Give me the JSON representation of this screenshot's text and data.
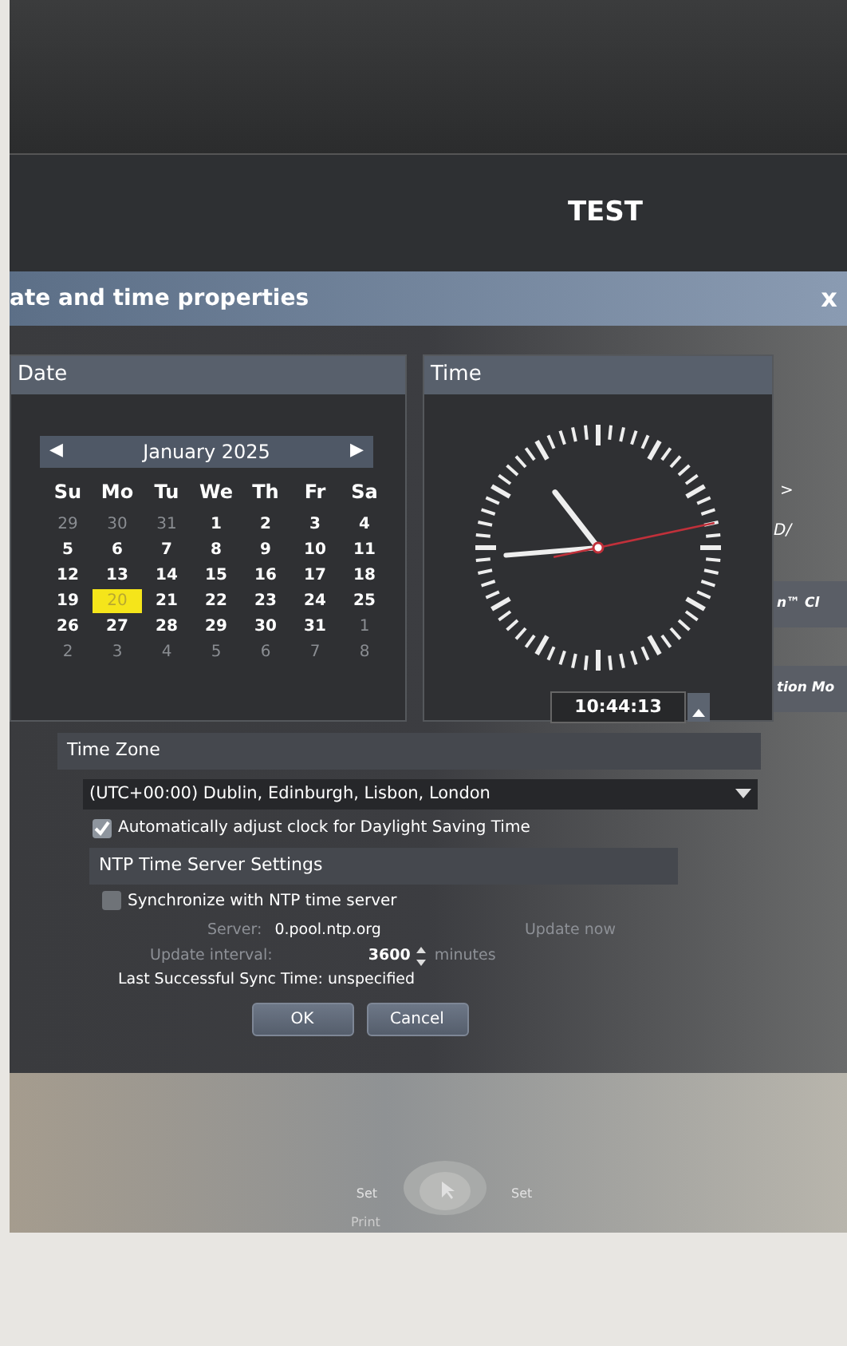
{
  "header": {
    "title": "TEST"
  },
  "dialog": {
    "title": "ate and time properties",
    "close": "x"
  },
  "date_panel": {
    "title": "Date",
    "calendar": {
      "prev": "◀",
      "month": "January 2025",
      "next": "▶",
      "weekdays": [
        "Su",
        "Mo",
        "Tu",
        "We",
        "Th",
        "Fr",
        "Sa"
      ],
      "weeks": [
        [
          {
            "day": "29",
            "muted": true,
            "selected": false
          },
          {
            "day": "30",
            "muted": true,
            "selected": false
          },
          {
            "day": "31",
            "muted": true,
            "selected": false
          },
          {
            "day": "1",
            "muted": false,
            "selected": false
          },
          {
            "day": "2",
            "muted": false,
            "selected": false
          },
          {
            "day": "3",
            "muted": false,
            "selected": false
          },
          {
            "day": "4",
            "muted": false,
            "selected": false
          }
        ],
        [
          {
            "day": "5",
            "muted": false,
            "selected": false
          },
          {
            "day": "6",
            "muted": false,
            "selected": false
          },
          {
            "day": "7",
            "muted": false,
            "selected": false
          },
          {
            "day": "8",
            "muted": false,
            "selected": false
          },
          {
            "day": "9",
            "muted": false,
            "selected": false
          },
          {
            "day": "10",
            "muted": false,
            "selected": false
          },
          {
            "day": "11",
            "muted": false,
            "selected": false
          }
        ],
        [
          {
            "day": "12",
            "muted": false,
            "selected": false
          },
          {
            "day": "13",
            "muted": false,
            "selected": false
          },
          {
            "day": "14",
            "muted": false,
            "selected": false
          },
          {
            "day": "15",
            "muted": false,
            "selected": false
          },
          {
            "day": "16",
            "muted": false,
            "selected": false
          },
          {
            "day": "17",
            "muted": false,
            "selected": false
          },
          {
            "day": "18",
            "muted": false,
            "selected": false
          }
        ],
        [
          {
            "day": "19",
            "muted": false,
            "selected": false
          },
          {
            "day": "20",
            "muted": false,
            "selected": true
          },
          {
            "day": "21",
            "muted": false,
            "selected": false
          },
          {
            "day": "22",
            "muted": false,
            "selected": false
          },
          {
            "day": "23",
            "muted": false,
            "selected": false
          },
          {
            "day": "24",
            "muted": false,
            "selected": false
          },
          {
            "day": "25",
            "muted": false,
            "selected": false
          }
        ],
        [
          {
            "day": "26",
            "muted": false,
            "selected": false
          },
          {
            "day": "27",
            "muted": false,
            "selected": false
          },
          {
            "day": "28",
            "muted": false,
            "selected": false
          },
          {
            "day": "29",
            "muted": false,
            "selected": false
          },
          {
            "day": "30",
            "muted": false,
            "selected": false
          },
          {
            "day": "31",
            "muted": false,
            "selected": false
          },
          {
            "day": "1",
            "muted": true,
            "selected": false
          }
        ],
        [
          {
            "day": "2",
            "muted": true,
            "selected": false
          },
          {
            "day": "3",
            "muted": true,
            "selected": false
          },
          {
            "day": "4",
            "muted": true,
            "selected": false
          },
          {
            "day": "5",
            "muted": true,
            "selected": false
          },
          {
            "day": "6",
            "muted": true,
            "selected": false
          },
          {
            "day": "7",
            "muted": true,
            "selected": false
          },
          {
            "day": "8",
            "muted": true,
            "selected": false
          }
        ]
      ]
    }
  },
  "time_panel": {
    "title": "Time",
    "time": "10:44:13"
  },
  "time_zone": {
    "title": "Time Zone",
    "zone": "(UTC+00:00) Dublin, Edinburgh, Lisbon, London",
    "dst": {
      "label": "Automatically adjust clock for Daylight Saving Time",
      "checked": true
    }
  },
  "ntp": {
    "title": "NTP Time Server Settings",
    "sync": {
      "label": "Synchronize with NTP time server",
      "checked": false
    },
    "server_label": "Server:",
    "server": "0.pool.ntp.org",
    "update_now": "Update now",
    "interval_label": "Update interval:",
    "interval": "3600",
    "interval_unit": "minutes",
    "last_sync": "Last Successful Sync Time: unspecified"
  },
  "buttons": [
    "OK",
    "Cancel"
  ],
  "side": {
    "marker": ">",
    "text": "D/",
    "buttons": [
      "n™ Cl",
      "tion Mo"
    ]
  },
  "bottom_bar": {
    "left": "Set",
    "right": "Set",
    "caption": "Print"
  }
}
